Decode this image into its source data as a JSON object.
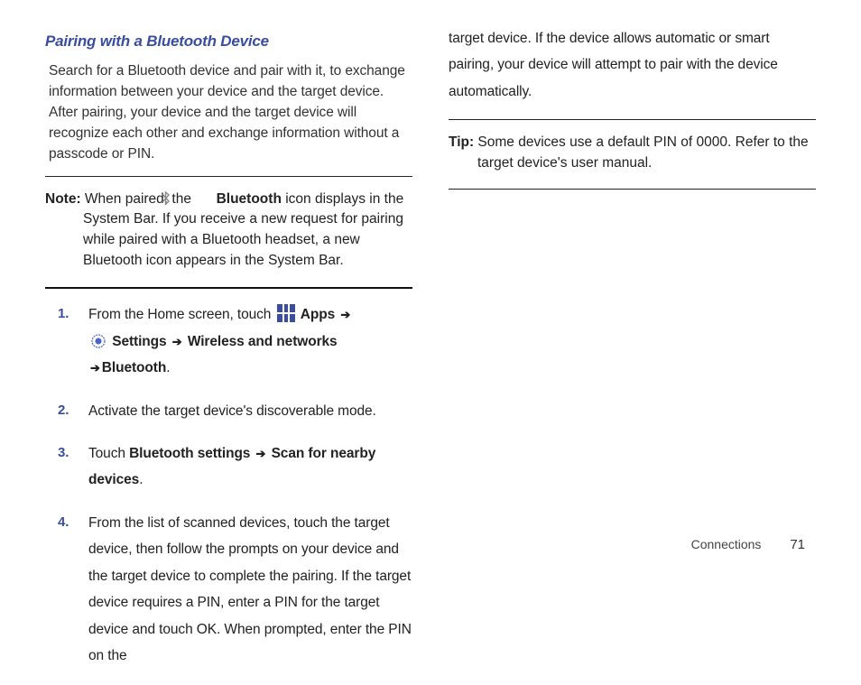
{
  "heading": "Pairing with a Bluetooth Device",
  "intro": "Search for a Bluetooth device and pair with it, to exchange information between your device and the target device. After pairing, your device and the target device will recognize each other and exchange information without a passcode or PIN.",
  "note": {
    "label": "Note:",
    "pre": " When paired, the ",
    "bt_bold": "Bluetooth",
    "post": " icon displays in the System Bar. If you receive a new request for pairing while paired with a Bluetooth headset, a new Bluetooth icon appears in the System Bar."
  },
  "steps": {
    "s1": {
      "pre": "From the Home screen, touch ",
      "apps": "Apps",
      "settings": "Settings",
      "wn": "Wireless and networks",
      "bt": "Bluetooth"
    },
    "s2": "Activate the target device's discoverable mode.",
    "s3": {
      "pre": "Touch ",
      "b1": "Bluetooth settings",
      "b2": "Scan for nearby devices"
    },
    "s4": "From the list of scanned devices, touch the target device, then follow the prompts on your device and the target device to complete the pairing. If the target device requires a PIN, enter a PIN for the target device and touch OK. When prompted, enter the PIN on the"
  },
  "col2": {
    "continuation": "target device. If the device allows automatic or smart pairing, your device will attempt to pair with the device automatically."
  },
  "tip": {
    "label": "Tip:",
    "text": " Some devices use a default PIN of 0000. Refer to the target device's user manual."
  },
  "footer": {
    "section": "Connections",
    "page": "71"
  },
  "arrow": "➔"
}
